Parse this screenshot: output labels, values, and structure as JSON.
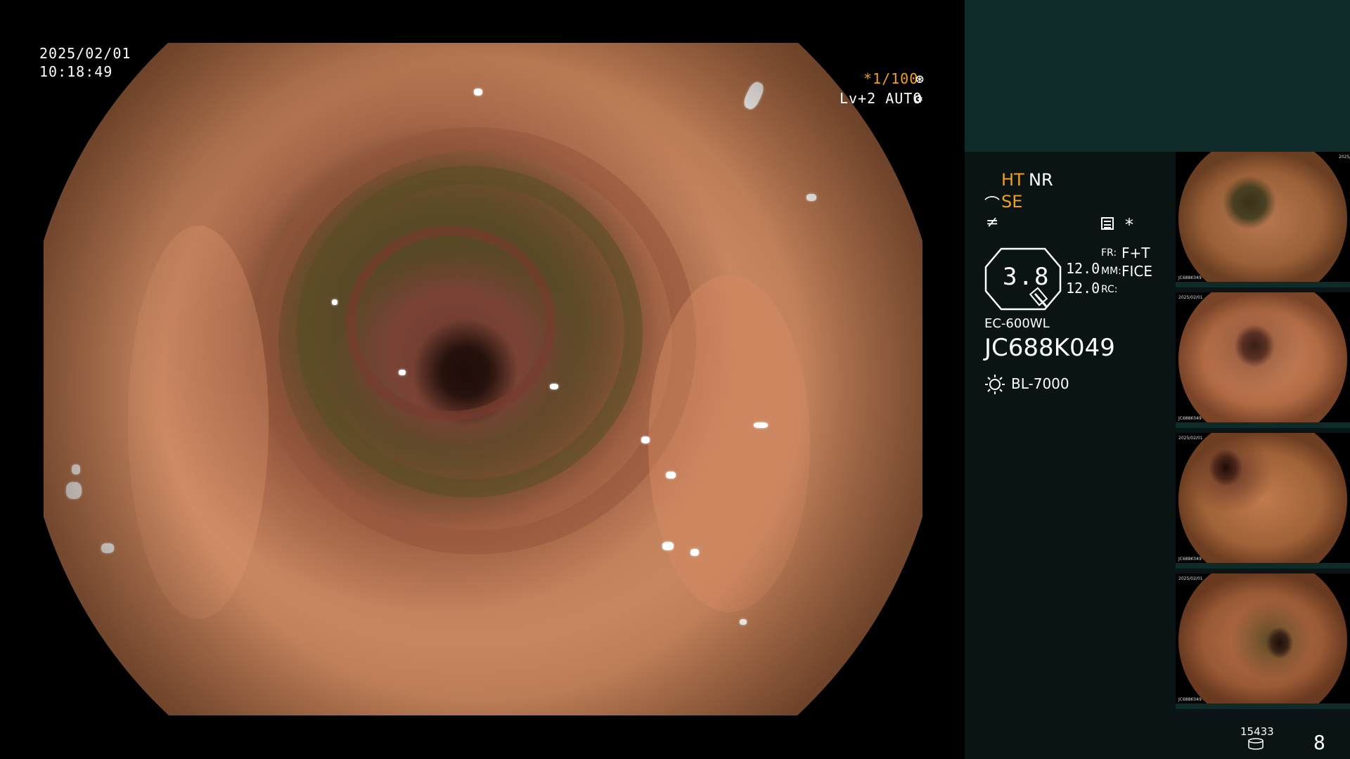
{
  "overlay": {
    "date": "2025/02/01",
    "time": "10:18:49",
    "shutter": "*1/100",
    "level_mode": "Lv+2 AUTO"
  },
  "panel": {
    "ht": "HT",
    "nr": "NR",
    "se": "SE",
    "zoom": "3.8",
    "val1": "12.0",
    "val2": "12.0",
    "fr_label": "FR:",
    "fr_value": "F+T",
    "mm_label": "MM:",
    "mm_value": "FICE",
    "rc_label": "RC:",
    "scope_model": "EC-600WL",
    "scope_serial": "JC688K049",
    "light_source": "BL-7000",
    "storage_count": "15433",
    "image_count": "8",
    "accent_color": "#f0a020"
  },
  "thumbnails": [
    {
      "date": "2025/02/01",
      "time": "10:18:49",
      "serial": "JC688K049",
      "source": "BL-7000"
    },
    {
      "date": "2025/02/01",
      "time": "10:18:49",
      "serial": "JC688K049",
      "source": "BL-7000"
    },
    {
      "date": "2025/02/01",
      "time": "10:18:49",
      "serial": "JC688K049",
      "source": "BL-7000"
    },
    {
      "date": "2025/02/01",
      "time": "10:18:49",
      "serial": "JC688K049",
      "source": "BL-7000"
    }
  ],
  "icons": {
    "shutter": "shutter-icon",
    "auto": "auto-exposure-icon",
    "structure": "structure-enhance-icon",
    "color": "color-mode-icon",
    "menu": "settings-list-icon",
    "star": "star-icon",
    "light": "light-source-icon",
    "storage": "storage-icon"
  }
}
